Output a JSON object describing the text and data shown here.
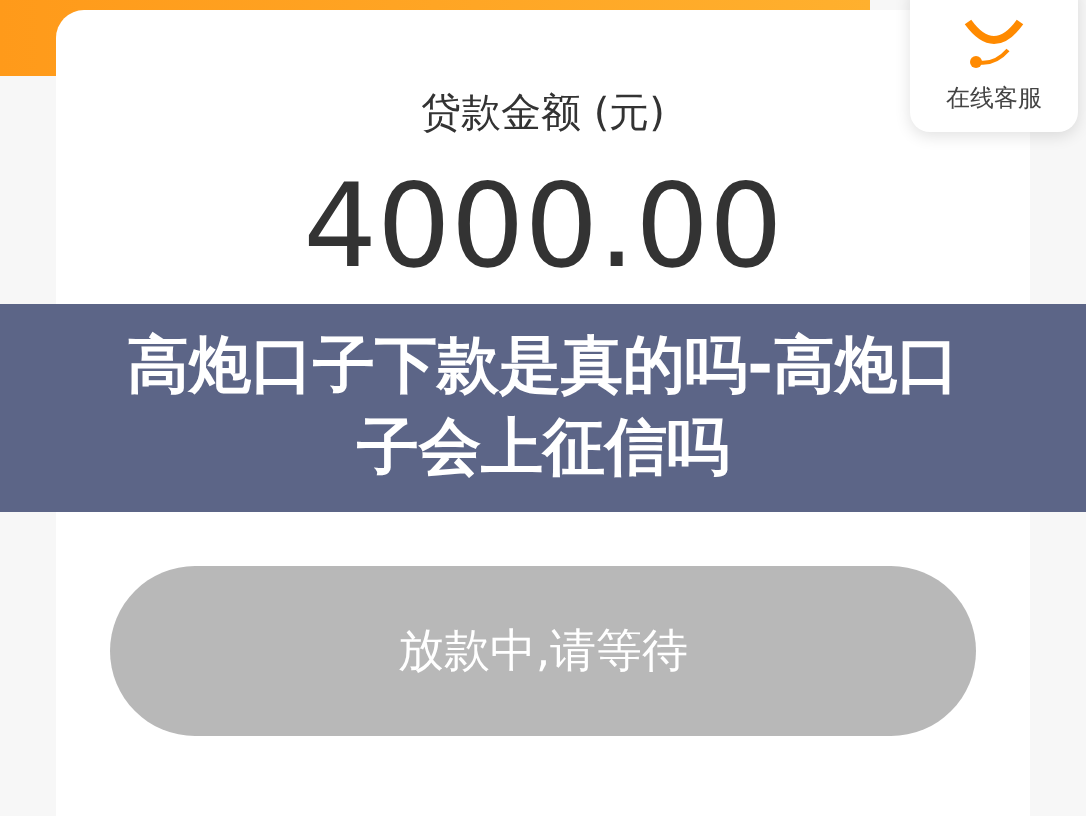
{
  "support_widget": {
    "label": "在线客服"
  },
  "loan_card": {
    "amount_label": "贷款金额 (元)",
    "amount": "4000.00"
  },
  "banner": {
    "title": "高炮口子下款是真的吗-高炮口子会上征信吗"
  },
  "action_button": {
    "label": "放款中,请等待",
    "disabled": true
  }
}
